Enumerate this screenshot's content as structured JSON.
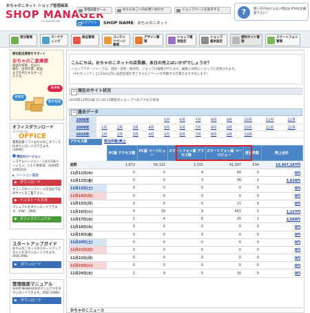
{
  "header": {
    "logo_sub": "おちゃのこネット ショップ管理画面",
    "logo_main_a": "SHOP",
    "logo_main_b": " MANAGER",
    "logo_domain": "OCHANOKO.NET",
    "buttons": [
      "管理画面ホーム",
      "おちゃのこへのお問い合わせ",
      "ショップページを表示する"
    ],
    "logout": "ログアウト",
    "shop_label": "SHOP NAME",
    "shop_name": "おちゃのこネット",
    "help_text": "使い方が分からない時はまずFAQを検索下さい！",
    "help_icon": "?"
  },
  "nav": [
    {
      "label": "受注管理",
      "color": "#6fb04a"
    },
    {
      "label": "マーケティング",
      "color": "#4fa3c9"
    },
    {
      "label": "商品管理",
      "color": "#e4574c"
    },
    {
      "label": "コンテンツページ管理",
      "color": "#e79a3c"
    },
    {
      "label": "デザイン管理",
      "color": "#e37c2d"
    },
    {
      "label": "ショップ運用設定",
      "color": "#9a6fc1"
    },
    {
      "label": "ショップ基本設定",
      "color": "#8c8c8c"
    },
    {
      "label": "便利サイト管理",
      "color": "#b8b8b8"
    },
    {
      "label": "スマートフォン管理",
      "color": "#7ab85a"
    }
  ],
  "sidebar": {
    "ad": {
      "title1": "梱包配送業務をサポート",
      "title2": "おちゃのこ倉庫便",
      "body": "商品の保管、仕分け、梱包、出荷作業、配送までを代行するサービスです。",
      "badge1": "倉庫型",
      "badge2": "低価格",
      "badge3": "簡単管理"
    },
    "office": {
      "title": "オフィスダウンロード",
      "brand_small": "OCHANOKO",
      "brand": "OFFICE",
      "body": "業務支援ソフトおちゃのこオフィスのダウンロードができます。(36MB)",
      "version_title": "現在のバージョン",
      "version_info": "システムバージョン：1.8.0 DBバージョン：1.1.0 更新日：2009年10月10日",
      "version_history": "バージョン履歴",
      "download": "ダウンロード",
      "install_note": "オフィスのインストール方法は下記のサイトをご覧下さい。",
      "install_btn": "インストール方法",
      "manual_note": "マニュアルをダウンロードできます。(PDF：2MB)",
      "manual_btn": "オフィスマニュアル"
    },
    "startup": {
      "title": "スタートアップガイド",
      "body": "おちゃのこネットのスタートアップガイドをダウンロードできます。(PDF:2MB)",
      "download": "ダウンロード"
    },
    "manual": {
      "title": "管理画面マニュアル",
      "body": "SHOP MANAGERのマニュアルをダウンロードできます。(PDF:20MB)",
      "download": "ダウンロード"
    }
  },
  "main": {
    "greeting": "こんにちは。おちゃのこネットの店長様、本日の売上はいかがでしょうか？",
    "notice1": "ショップマネージャーでは、登録・変更・削除等、ショップの編集が行えます。編集と同時にショップに反映されます。",
    "notice2": "（※セキュリティ上120分以内に設定処理を完了するなどページを移動する作業をおすすめします）",
    "site_status": "現在のサイト状況",
    "timestamp": "2010年11月24日 11:26:13現在のショップへのアクセス状況",
    "past_data": "過去データ",
    "years": [
      {
        "year": "2008年",
        "months": [
          "",
          "",
          "",
          "",
          "5月",
          "6月",
          "7月",
          "8月",
          "9月",
          "10月",
          "11月",
          "12月"
        ]
      },
      {
        "year": "2009年",
        "months": [
          "1月",
          "2月",
          "3月",
          "4月",
          "5月",
          "6月",
          "7月",
          "8月",
          "9月",
          "10月",
          "11月",
          "12月"
        ]
      },
      {
        "year": "2010年",
        "months": [
          "1月",
          "2月",
          "3月",
          "4月",
          "5月",
          "6月",
          "7月",
          "8月",
          "9月",
          "10月",
          "",
          ""
        ]
      }
    ],
    "subtab_access": "アクセス数",
    "subtab_orders": "受注件数/売上",
    "columns": [
      "",
      "PC版 アクセス数",
      "PC版 ページビュー",
      "スマートフォン版 アクセス数",
      "スマートフォン版 ページビュー",
      "受注件数",
      "売上合計"
    ],
    "total": {
      "label": "総数",
      "pc_access": "1,872",
      "pc_pv": "56,122",
      "sp_access": "1,315",
      "sp_pv": "41,397",
      "orders": "634",
      "sales": "13,467,197円"
    },
    "rows": [
      {
        "date": "11月11日(木)",
        "type": "",
        "v": [
          "0",
          "0",
          "4",
          "40",
          "0"
        ],
        "sales": "0円"
      },
      {
        "date": "11月12日(金)",
        "type": "",
        "v": [
          "0",
          "0",
          "3",
          "36",
          "2"
        ],
        "sales": "5,620円"
      },
      {
        "date": "11月13日(土)",
        "type": "sat",
        "v": [
          "0",
          "0",
          "0",
          "0",
          "0"
        ],
        "sales": "0円"
      },
      {
        "date": "11月14日(日)",
        "type": "sun",
        "v": [
          "0",
          "0",
          "0",
          "0",
          "0"
        ],
        "sales": "0円"
      },
      {
        "date": "11月15日(月)",
        "type": "",
        "v": [
          "0",
          "0",
          "0",
          "21",
          "0"
        ],
        "sales": "0円"
      },
      {
        "date": "11月16日(火)",
        "type": "",
        "v": [
          "4",
          "39",
          "9",
          "441",
          "1"
        ],
        "sales": "1,227円"
      },
      {
        "date": "11月17日(水)",
        "type": "",
        "v": [
          "1",
          "4",
          "6",
          "25",
          "1"
        ],
        "sales": "2,500円"
      },
      {
        "date": "11月18日(木)",
        "type": "",
        "v": [
          "0",
          "0",
          "0",
          "0",
          "0"
        ],
        "sales": "0円"
      },
      {
        "date": "11月19日(金)",
        "type": "",
        "v": [
          "0",
          "0",
          "0",
          "0",
          "0"
        ],
        "sales": "0円"
      },
      {
        "date": "11月20日(土)",
        "type": "sat",
        "v": [
          "0",
          "0",
          "0",
          "0",
          "0"
        ],
        "sales": "0円"
      },
      {
        "date": "11月21日(日)",
        "type": "sun",
        "v": [
          "0",
          "0",
          "0",
          "0",
          "0"
        ],
        "sales": "0円"
      },
      {
        "date": "11月22日(月)",
        "type": "",
        "v": [
          "0",
          "0",
          "0",
          "0",
          "0"
        ],
        "sales": "0円"
      },
      {
        "date": "11月23日(火)",
        "type": "sun",
        "v": [
          "0",
          "0",
          "0",
          "0",
          "0"
        ],
        "sales": "0円"
      },
      {
        "date": "11月24日(水)",
        "type": "",
        "v": [
          "2",
          "9",
          "5",
          "30",
          "0"
        ],
        "sales": "0円"
      }
    ],
    "news_title": "おちゃのこニュース"
  }
}
